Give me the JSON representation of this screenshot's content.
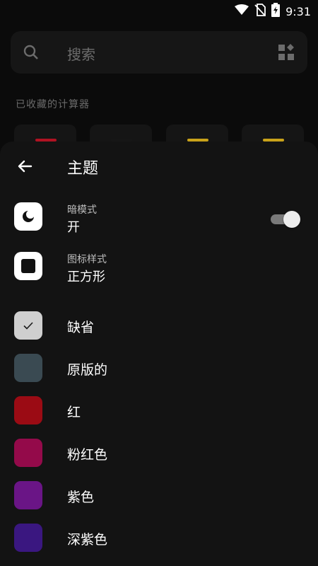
{
  "status_bar": {
    "time": "9:31",
    "icons": [
      "wifi-icon",
      "no-sim-icon",
      "battery-charging-icon"
    ]
  },
  "background": {
    "search_placeholder": "搜索",
    "section_title": "已收藏的计算器",
    "card_accents": [
      "#b01222",
      "#161616",
      "#c9a21a",
      "#c9a21a"
    ]
  },
  "sheet": {
    "title": "主题",
    "dark_mode": {
      "label": "暗模式",
      "value": "开",
      "enabled": true
    },
    "icon_style": {
      "label": "图标样式",
      "value": "正方形"
    },
    "colors": [
      {
        "label": "缺省",
        "swatch": "#cfcfcf",
        "selected": true
      },
      {
        "label": "原版的",
        "swatch": "#3a4a52",
        "selected": false
      },
      {
        "label": "红",
        "swatch": "#9b0b14",
        "selected": false
      },
      {
        "label": "粉红色",
        "swatch": "#940a4a",
        "selected": false
      },
      {
        "label": "紫色",
        "swatch": "#6a1586",
        "selected": false
      },
      {
        "label": "深紫色",
        "swatch": "#3a1780",
        "selected": false
      }
    ]
  }
}
